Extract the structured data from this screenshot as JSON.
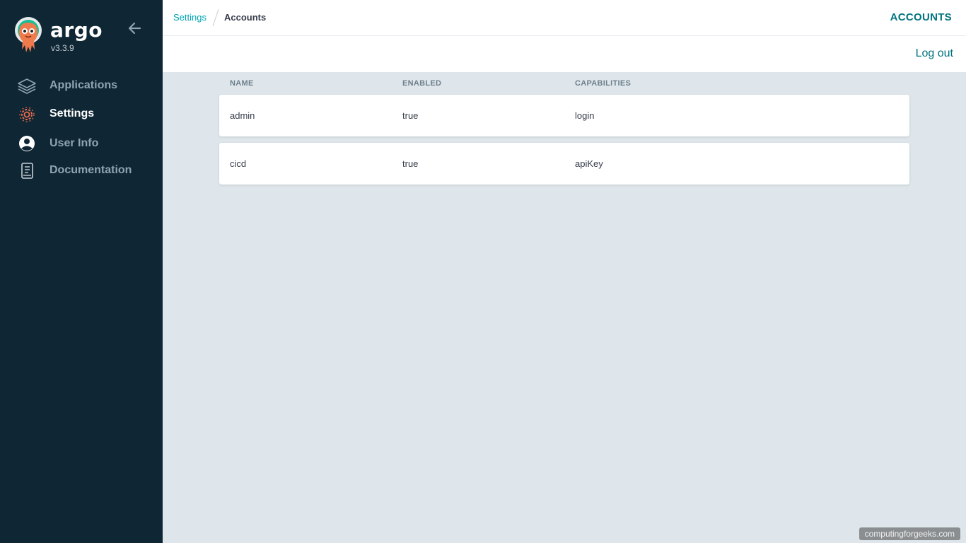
{
  "brand": {
    "name": "argo",
    "version": "v3.3.9"
  },
  "nav": {
    "items": [
      {
        "label": "Applications",
        "icon": "layers-icon"
      },
      {
        "label": "Settings",
        "icon": "gear-icon"
      },
      {
        "label": "User Info",
        "icon": "user-circle-icon"
      },
      {
        "label": "Documentation",
        "icon": "document-icon"
      }
    ],
    "active": "Settings"
  },
  "breadcrumb": {
    "root": "Settings",
    "current": "Accounts"
  },
  "header": {
    "title": "ACCOUNTS"
  },
  "toolbar": {
    "logout_label": "Log out"
  },
  "table": {
    "columns": [
      "NAME",
      "ENABLED",
      "CAPABILITIES"
    ],
    "rows": [
      {
        "name": "admin",
        "enabled": "true",
        "capabilities": "login"
      },
      {
        "name": "cicd",
        "enabled": "true",
        "capabilities": "apiKey"
      }
    ]
  },
  "watermark": "computingforgeeks.com",
  "colors": {
    "sidebar": "#0f2634",
    "accent": "#00737f",
    "link": "#00a2b3",
    "settings_icon": "#e96d4c",
    "background": "#dee6eb"
  }
}
